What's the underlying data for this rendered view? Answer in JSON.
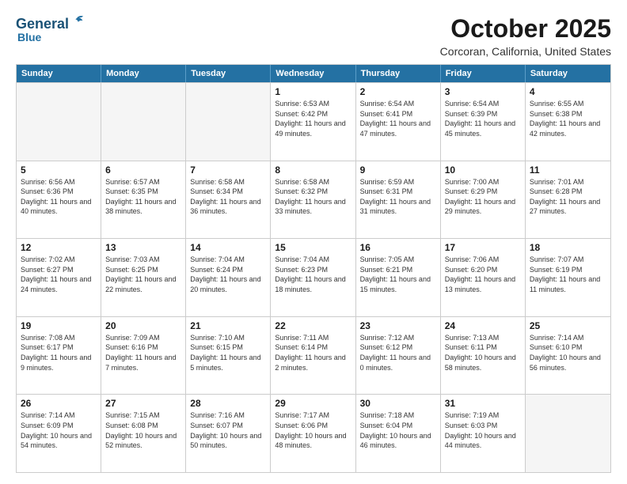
{
  "header": {
    "logo_general": "General",
    "logo_blue": "Blue",
    "month": "October 2025",
    "location": "Corcoran, California, United States"
  },
  "weekdays": [
    "Sunday",
    "Monday",
    "Tuesday",
    "Wednesday",
    "Thursday",
    "Friday",
    "Saturday"
  ],
  "rows": [
    [
      {
        "day": "",
        "text": "",
        "empty": true
      },
      {
        "day": "",
        "text": "",
        "empty": true
      },
      {
        "day": "",
        "text": "",
        "empty": true
      },
      {
        "day": "1",
        "text": "Sunrise: 6:53 AM\nSunset: 6:42 PM\nDaylight: 11 hours and 49 minutes."
      },
      {
        "day": "2",
        "text": "Sunrise: 6:54 AM\nSunset: 6:41 PM\nDaylight: 11 hours and 47 minutes."
      },
      {
        "day": "3",
        "text": "Sunrise: 6:54 AM\nSunset: 6:39 PM\nDaylight: 11 hours and 45 minutes."
      },
      {
        "day": "4",
        "text": "Sunrise: 6:55 AM\nSunset: 6:38 PM\nDaylight: 11 hours and 42 minutes."
      }
    ],
    [
      {
        "day": "5",
        "text": "Sunrise: 6:56 AM\nSunset: 6:36 PM\nDaylight: 11 hours and 40 minutes."
      },
      {
        "day": "6",
        "text": "Sunrise: 6:57 AM\nSunset: 6:35 PM\nDaylight: 11 hours and 38 minutes."
      },
      {
        "day": "7",
        "text": "Sunrise: 6:58 AM\nSunset: 6:34 PM\nDaylight: 11 hours and 36 minutes."
      },
      {
        "day": "8",
        "text": "Sunrise: 6:58 AM\nSunset: 6:32 PM\nDaylight: 11 hours and 33 minutes."
      },
      {
        "day": "9",
        "text": "Sunrise: 6:59 AM\nSunset: 6:31 PM\nDaylight: 11 hours and 31 minutes."
      },
      {
        "day": "10",
        "text": "Sunrise: 7:00 AM\nSunset: 6:29 PM\nDaylight: 11 hours and 29 minutes."
      },
      {
        "day": "11",
        "text": "Sunrise: 7:01 AM\nSunset: 6:28 PM\nDaylight: 11 hours and 27 minutes."
      }
    ],
    [
      {
        "day": "12",
        "text": "Sunrise: 7:02 AM\nSunset: 6:27 PM\nDaylight: 11 hours and 24 minutes."
      },
      {
        "day": "13",
        "text": "Sunrise: 7:03 AM\nSunset: 6:25 PM\nDaylight: 11 hours and 22 minutes."
      },
      {
        "day": "14",
        "text": "Sunrise: 7:04 AM\nSunset: 6:24 PM\nDaylight: 11 hours and 20 minutes."
      },
      {
        "day": "15",
        "text": "Sunrise: 7:04 AM\nSunset: 6:23 PM\nDaylight: 11 hours and 18 minutes."
      },
      {
        "day": "16",
        "text": "Sunrise: 7:05 AM\nSunset: 6:21 PM\nDaylight: 11 hours and 15 minutes."
      },
      {
        "day": "17",
        "text": "Sunrise: 7:06 AM\nSunset: 6:20 PM\nDaylight: 11 hours and 13 minutes."
      },
      {
        "day": "18",
        "text": "Sunrise: 7:07 AM\nSunset: 6:19 PM\nDaylight: 11 hours and 11 minutes."
      }
    ],
    [
      {
        "day": "19",
        "text": "Sunrise: 7:08 AM\nSunset: 6:17 PM\nDaylight: 11 hours and 9 minutes."
      },
      {
        "day": "20",
        "text": "Sunrise: 7:09 AM\nSunset: 6:16 PM\nDaylight: 11 hours and 7 minutes."
      },
      {
        "day": "21",
        "text": "Sunrise: 7:10 AM\nSunset: 6:15 PM\nDaylight: 11 hours and 5 minutes."
      },
      {
        "day": "22",
        "text": "Sunrise: 7:11 AM\nSunset: 6:14 PM\nDaylight: 11 hours and 2 minutes."
      },
      {
        "day": "23",
        "text": "Sunrise: 7:12 AM\nSunset: 6:12 PM\nDaylight: 11 hours and 0 minutes."
      },
      {
        "day": "24",
        "text": "Sunrise: 7:13 AM\nSunset: 6:11 PM\nDaylight: 10 hours and 58 minutes."
      },
      {
        "day": "25",
        "text": "Sunrise: 7:14 AM\nSunset: 6:10 PM\nDaylight: 10 hours and 56 minutes."
      }
    ],
    [
      {
        "day": "26",
        "text": "Sunrise: 7:14 AM\nSunset: 6:09 PM\nDaylight: 10 hours and 54 minutes."
      },
      {
        "day": "27",
        "text": "Sunrise: 7:15 AM\nSunset: 6:08 PM\nDaylight: 10 hours and 52 minutes."
      },
      {
        "day": "28",
        "text": "Sunrise: 7:16 AM\nSunset: 6:07 PM\nDaylight: 10 hours and 50 minutes."
      },
      {
        "day": "29",
        "text": "Sunrise: 7:17 AM\nSunset: 6:06 PM\nDaylight: 10 hours and 48 minutes."
      },
      {
        "day": "30",
        "text": "Sunrise: 7:18 AM\nSunset: 6:04 PM\nDaylight: 10 hours and 46 minutes."
      },
      {
        "day": "31",
        "text": "Sunrise: 7:19 AM\nSunset: 6:03 PM\nDaylight: 10 hours and 44 minutes."
      },
      {
        "day": "",
        "text": "",
        "empty": true
      }
    ]
  ]
}
